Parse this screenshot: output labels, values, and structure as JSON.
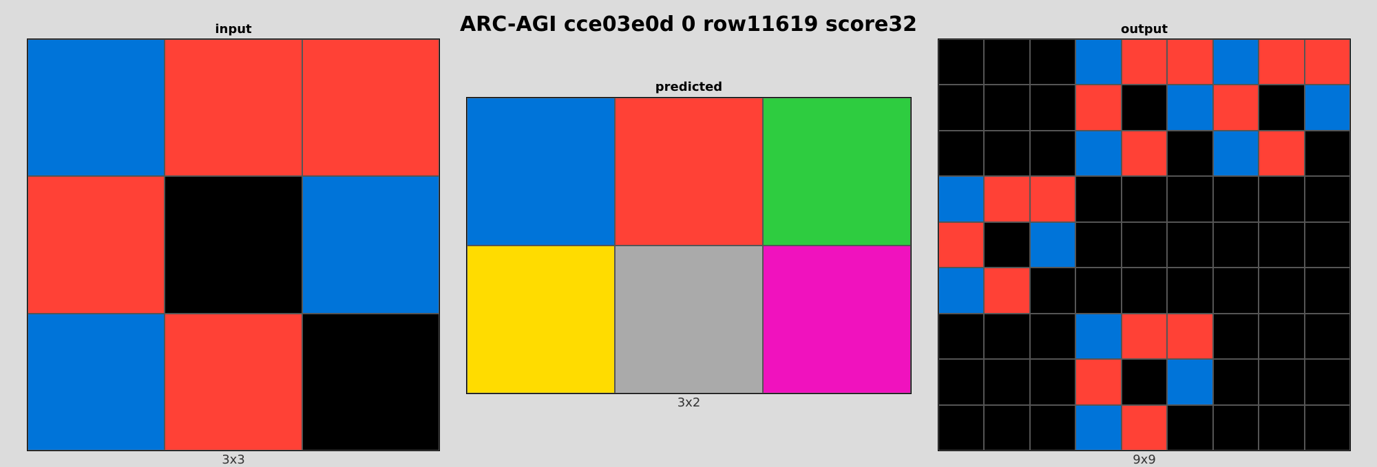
{
  "title": "ARC-AGI cce03e0d 0 row11619 score32",
  "palette": {
    "0": "#000000",
    "1": "#0074d9",
    "2": "#ff4136",
    "3": "#2ecc40",
    "4": "#ffdc00",
    "5": "#aaaaaa",
    "6": "#f012be"
  },
  "panels": {
    "input": {
      "label": "input",
      "dims": "3x3",
      "grid": [
        [
          1,
          2,
          2
        ],
        [
          2,
          0,
          1
        ],
        [
          1,
          2,
          0
        ]
      ]
    },
    "predicted": {
      "label": "predicted",
      "dims": "3x2",
      "grid": [
        [
          1,
          2,
          3
        ],
        [
          4,
          5,
          6
        ]
      ]
    },
    "output": {
      "label": "output",
      "dims": "9x9",
      "grid": [
        [
          0,
          0,
          0,
          1,
          2,
          2,
          1,
          2,
          2
        ],
        [
          0,
          0,
          0,
          2,
          0,
          1,
          2,
          0,
          1
        ],
        [
          0,
          0,
          0,
          1,
          2,
          0,
          1,
          2,
          0
        ],
        [
          1,
          2,
          2,
          0,
          0,
          0,
          0,
          0,
          0
        ],
        [
          2,
          0,
          1,
          0,
          0,
          0,
          0,
          0,
          0
        ],
        [
          1,
          2,
          0,
          0,
          0,
          0,
          0,
          0,
          0
        ],
        [
          0,
          0,
          0,
          1,
          2,
          2,
          0,
          0,
          0
        ],
        [
          0,
          0,
          0,
          2,
          0,
          1,
          0,
          0,
          0
        ],
        [
          0,
          0,
          0,
          1,
          2,
          0,
          0,
          0,
          0
        ]
      ]
    }
  }
}
